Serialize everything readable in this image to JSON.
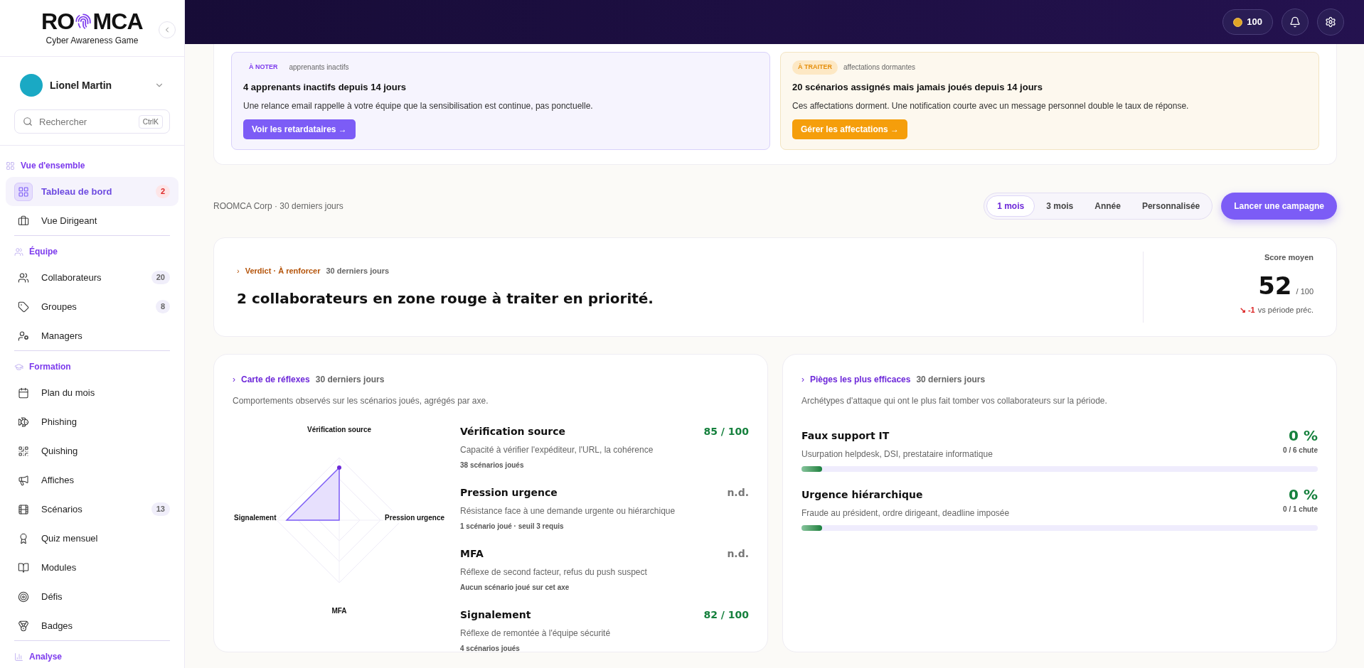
{
  "sidebar": {
    "logo": {
      "left": "RO",
      "right": "MCA",
      "tagline": "Cyber Awareness Game"
    },
    "user": {
      "name": "Lionel Martin"
    },
    "search": {
      "placeholder": "Rechercher",
      "shortcut": "CtrlK"
    },
    "sections": [
      {
        "title": "Vue d'ensemble",
        "items": [
          {
            "label": "Tableau de bord",
            "kind": "alert",
            "selected": true,
            "badge": "2"
          },
          {
            "label": "Vue Dirigeant",
            "selected": false
          }
        ]
      },
      {
        "title": "Équipe",
        "items": [
          {
            "label": "Collaborateurs",
            "kind": "count",
            "selected": false,
            "badge": "20"
          },
          {
            "label": "Groupes",
            "kind": "count",
            "selected": false,
            "badge": "8"
          },
          {
            "label": "Managers",
            "selected": false
          }
        ]
      },
      {
        "title": "Formation",
        "items": [
          {
            "label": "Plan du mois",
            "selected": false
          },
          {
            "label": "Phishing",
            "selected": false
          },
          {
            "label": "Quishing",
            "selected": false
          },
          {
            "label": "Affiches",
            "selected": false
          },
          {
            "label": "Scénarios",
            "kind": "count",
            "selected": false,
            "badge": "13"
          },
          {
            "label": "Quiz mensuel",
            "selected": false
          },
          {
            "label": "Modules",
            "selected": false
          },
          {
            "label": "Défis",
            "selected": false
          },
          {
            "label": "Badges",
            "selected": false
          }
        ]
      },
      {
        "title": "Analyse"
      }
    ]
  },
  "topbar": {
    "coins": "100"
  },
  "alerts": [
    {
      "kind": "note",
      "tag": "À NOTER",
      "context": "apprenants inactifs",
      "title": "4 apprenants inactifs depuis 14 jours",
      "text": "Une relance email rappelle à votre équipe que la sensibilisation est continue, pas ponctuelle.",
      "button": "Voir les retardataires →"
    },
    {
      "kind": "todo",
      "tag": "À TRAITER",
      "context": "affectations dormantes",
      "title": "20 scénarios assignés mais jamais joués depuis 14 jours",
      "text": "Ces affectations dorment. Une notification courte avec un message personnel double le taux de réponse.",
      "button": "Gérer les affectations →"
    }
  ],
  "toolbar": {
    "context": "ROOMCA Corp · 30 derniers jours",
    "periods": [
      {
        "label": "1 mois",
        "selected": true
      },
      {
        "label": "3 mois",
        "selected": false
      },
      {
        "label": "Année",
        "selected": false
      },
      {
        "label": "Personnalisée",
        "selected": false
      }
    ],
    "cta": "Lancer une campagne"
  },
  "verdict": {
    "chevron": "›",
    "label": "Verdict · À renforcer",
    "period": "30 derniers jours",
    "headline": "2 collaborateurs en zone rouge à traiter en priorité.",
    "score_label": "Score moyen",
    "score": "52",
    "score_max": "/ 100",
    "delta": "↘ -1",
    "delta_text": "vs période préc."
  },
  "reflexes": {
    "chevron": "›",
    "title": "Carte de réflexes",
    "period": "30 derniers jours",
    "subtitle": "Comportements observés sur les scénarios joués, agrégés par axe.",
    "radar_labels": [
      "Vérification source",
      "Pression urgence",
      "MFA",
      "Signalement"
    ],
    "axes": [
      {
        "name": "Vérification source",
        "description": "Capacité à vérifier l'expéditeur, l'URL, la cohérence",
        "note": "38 scénarios joués",
        "score": "85 / 100",
        "available": true
      },
      {
        "name": "Pression urgence",
        "description": "Résistance face à une demande urgente ou hiérarchique",
        "note": "1 scénario joué · seuil 3 requis",
        "score": "n.d.",
        "available": false
      },
      {
        "name": "MFA",
        "description": "Réflexe de second facteur, refus du push suspect",
        "note": "Aucun scénario joué sur cet axe",
        "score": "n.d.",
        "available": false
      },
      {
        "name": "Signalement",
        "description": "Réflexe de remontée à l'équipe sécurité",
        "note": "4 scénarios joués",
        "score": "82 / 100",
        "available": true
      }
    ]
  },
  "traps": {
    "chevron": "›",
    "title": "Pièges les plus efficaces",
    "period": "30 derniers jours",
    "subtitle": "Archétypes d'attaque qui ont le plus fait tomber vos collaborateurs sur la période.",
    "items": [
      {
        "name": "Faux support IT",
        "description": "Usurpation helpdesk, DSI, prestataire informatique",
        "rate": "0 %",
        "count": "0 / 6 chute",
        "level": 0.04
      },
      {
        "name": "Urgence hiérarchique",
        "description": "Fraude au président, ordre dirigeant, deadline imposée",
        "rate": "0 %",
        "count": "0 / 1 chute",
        "level": 0.04
      }
    ]
  }
}
